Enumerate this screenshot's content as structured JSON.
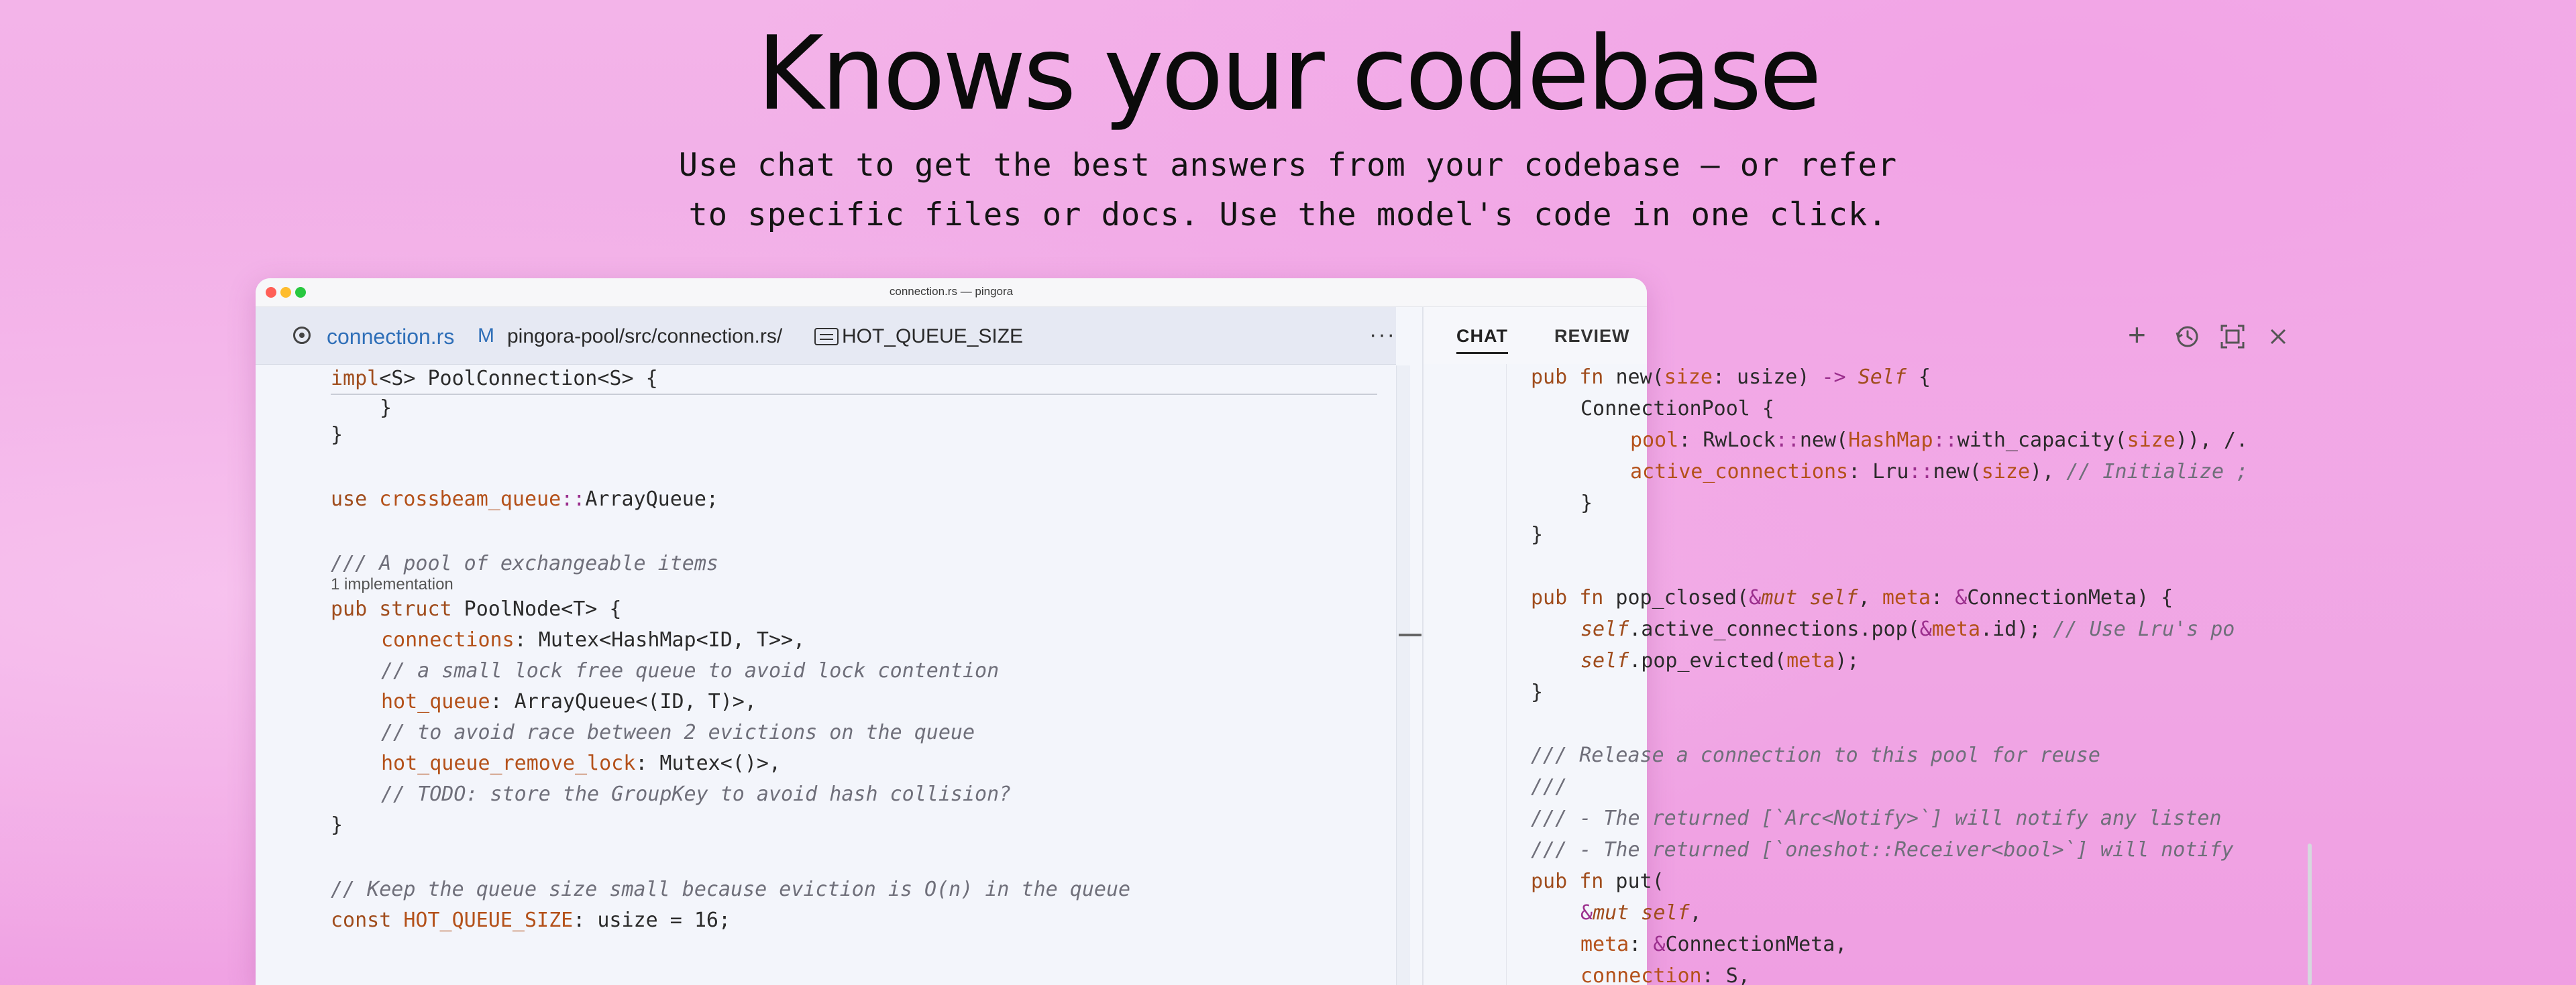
{
  "hero": {
    "title": "Knows your codebase",
    "subtitle_line1": "Use chat to get the best answers from your codebase — or refer",
    "subtitle_line2": "to specific files or docs. Use the model's code in one click."
  },
  "window": {
    "title": "connection.rs — pingora"
  },
  "editor": {
    "tab": {
      "file": "connection.rs",
      "status": "M",
      "path": "pingora-pool/src/connection.rs/",
      "symbol": "HOT_QUEUE_SIZE"
    },
    "impl_header": "impl<S> PoolConnection<S> {",
    "brace1": "}",
    "brace2": "}",
    "use_stmt": "use crossbeam_queue::ArrayQueue;",
    "doc1": "/// A pool of exchangeable items",
    "implementations": "1 implementation",
    "struct_decl": "pub struct PoolNode<T> {",
    "f1": "connections: Mutex<HashMap<ID, T>>,",
    "c1": "// a small lock free queue to avoid lock contention",
    "f2": "hot_queue: ArrayQueue<(ID, T)>,",
    "c2": "// to avoid race between 2 evictions on the queue",
    "f3": "hot_queue_remove_lock: Mutex<()>,",
    "c3": "// TODO: store the GroupKey to avoid hash collision?",
    "brace3": "}",
    "c4": "// Keep the queue size small because eviction is O(n) in the queue",
    "const_decl": "const HOT_QUEUE_SIZE: usize = 16;"
  },
  "chat": {
    "tabs": [
      "CHAT",
      "REVIEW"
    ],
    "lines": [
      "pub fn new(size: usize) -> Self {",
      "ConnectionPool {",
      "pool: RwLock::new(HashMap::with_capacity(size)), /.",
      "active_connections: Lru::new(size), // Initialize ;",
      "}",
      "}",
      "pub fn pop_closed(&mut self, meta: &ConnectionMeta) {",
      "self.active_connections.pop(&meta.id); // Use Lru's po",
      "self.pop_evicted(meta);",
      "}",
      "/// Release a connection to this pool for reuse",
      "///",
      "/// - The returned [`Arc<Notify>`] will notify any listen",
      "/// - The returned [`oneshot::Receiver<bool>`] will notify",
      "pub fn put(",
      "&mut self,",
      "meta: &ConnectionMeta,",
      "connection: S,"
    ]
  }
}
